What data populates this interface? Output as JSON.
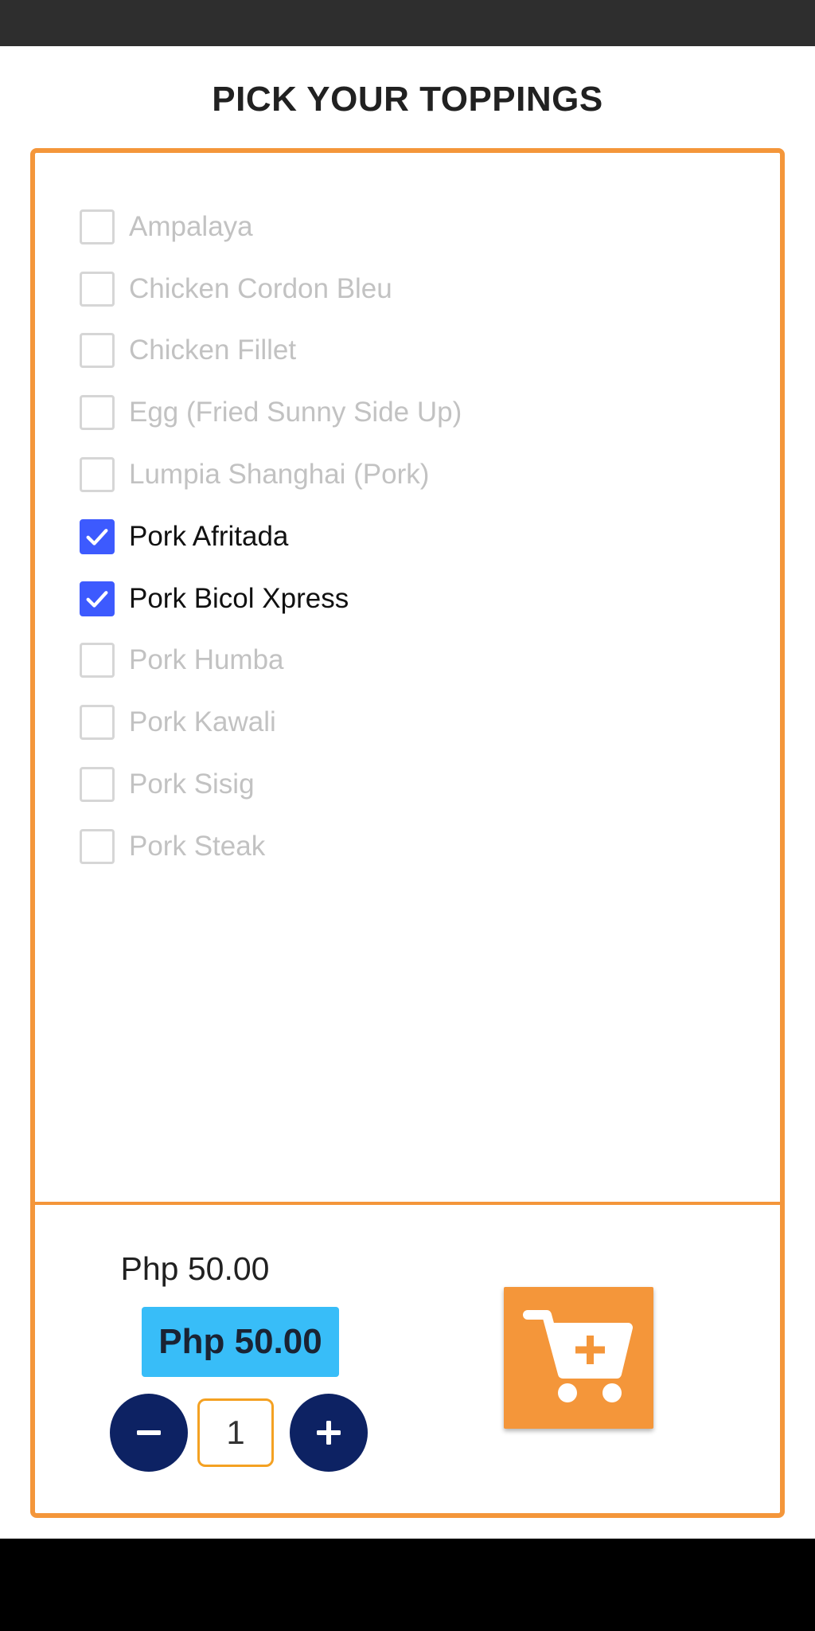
{
  "page": {
    "title": "PICK YOUR TOPPINGS"
  },
  "toppings": [
    {
      "label": "Ampalaya",
      "checked": false
    },
    {
      "label": "Chicken Cordon Bleu",
      "checked": false
    },
    {
      "label": "Chicken Fillet",
      "checked": false
    },
    {
      "label": "Egg (Fried Sunny Side Up)",
      "checked": false
    },
    {
      "label": "Lumpia Shanghai (Pork)",
      "checked": false
    },
    {
      "label": "Pork Afritada",
      "checked": true
    },
    {
      "label": "Pork Bicol Xpress",
      "checked": true
    },
    {
      "label": "Pork Humba",
      "checked": false
    },
    {
      "label": "Pork Kawali",
      "checked": false
    },
    {
      "label": "Pork Sisig",
      "checked": false
    },
    {
      "label": "Pork Steak",
      "checked": false
    }
  ],
  "order": {
    "unit_price": "Php 50.00",
    "total_price": "Php 50.00",
    "quantity": "1"
  },
  "icons": {
    "minus": "minus-icon",
    "plus": "plus-icon",
    "cart": "add-to-cart-icon",
    "check": "check-icon"
  },
  "colors": {
    "accent": "#f4963a",
    "checkbox_checked": "#3d5afe",
    "price_badge": "#38bdf8",
    "qty_button": "#0d2263",
    "qty_field_border": "#f4a122"
  }
}
